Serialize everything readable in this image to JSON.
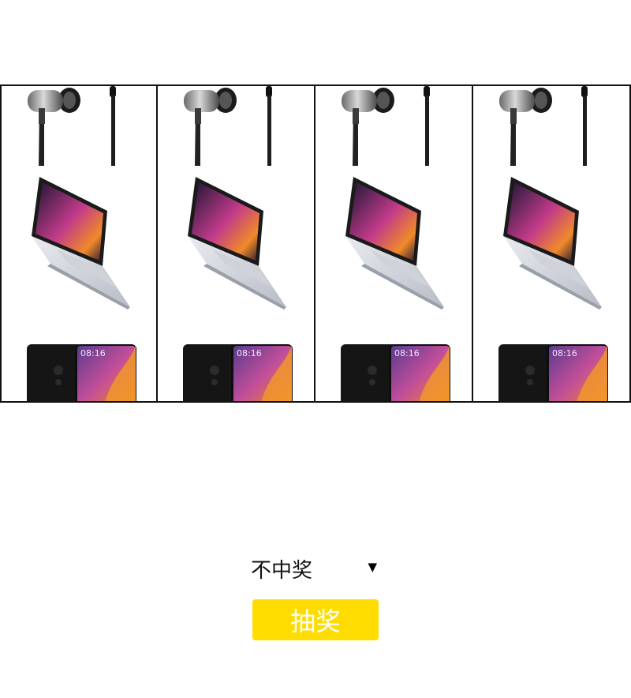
{
  "reels": [
    {
      "items": [
        "earphones",
        "laptop",
        "phone"
      ]
    },
    {
      "items": [
        "earphones",
        "laptop",
        "phone"
      ]
    },
    {
      "items": [
        "earphones",
        "laptop",
        "phone"
      ]
    },
    {
      "items": [
        "earphones",
        "laptop",
        "phone"
      ]
    }
  ],
  "phone_screen_time": "08:16",
  "prize_select": {
    "selected": "不中奖"
  },
  "draw_button": {
    "label": "抽奖"
  },
  "colors": {
    "button_bg": "#ffdc00",
    "button_text": "#ffffff",
    "reel_border": "#111111"
  }
}
